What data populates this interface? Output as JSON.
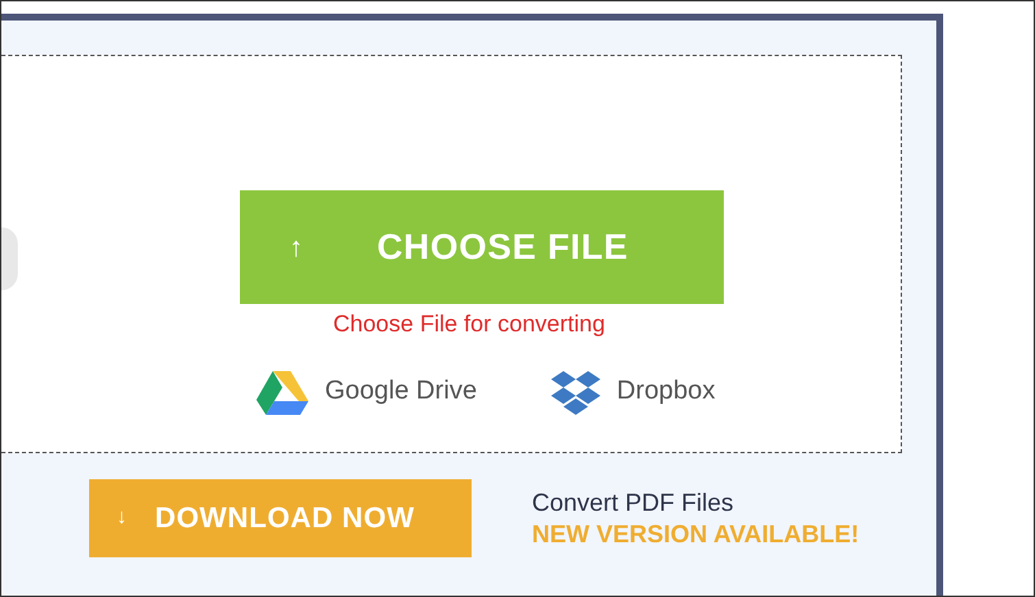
{
  "upload": {
    "choose_button": {
      "icon": "↑",
      "label": "CHOOSE FILE"
    },
    "hint": "Choose File for converting",
    "sources": [
      {
        "kind": "drive",
        "label": "Google Drive"
      },
      {
        "kind": "dropbox",
        "label": "Dropbox"
      }
    ]
  },
  "download": {
    "button": {
      "icon": "↓",
      "label": "DOWNLOAD NOW"
    },
    "title": "Convert PDF Files",
    "badge": "NEW VERSION AVAILABLE!"
  }
}
